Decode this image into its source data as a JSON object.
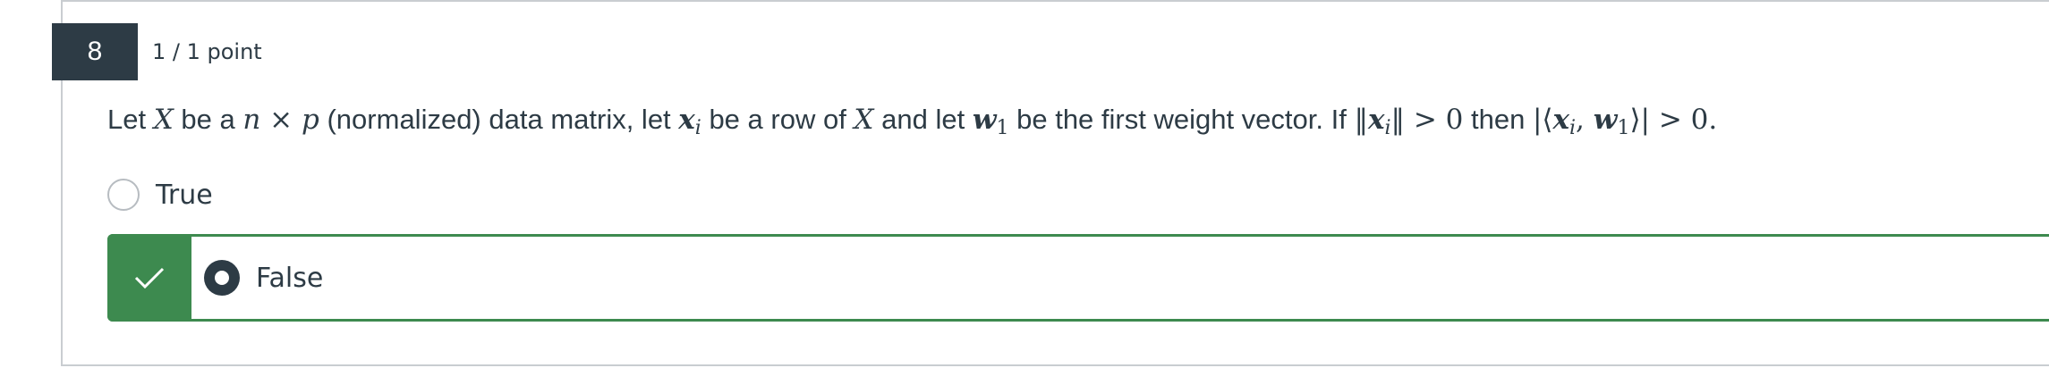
{
  "question": {
    "number": "8",
    "points": "1 / 1 point",
    "prompt": {
      "t1": "Let ",
      "X1": "X",
      "t2": " be a ",
      "n": "n",
      "times": " × ",
      "p": "p",
      "t3": " (normalized) data matrix, let ",
      "xi_x": "x",
      "xi_i": "i",
      "t4": " be a row of ",
      "X2": "X",
      "t5": " and let ",
      "w1_w": "w",
      "w1_1": "1",
      "t6": " be the first weight vector. If ",
      "norm_open": "‖",
      "norm_x": "x",
      "norm_i": "i",
      "norm_close": "‖",
      "gt1": " > 0",
      "t7": " then ",
      "abs_open": "|⟨",
      "ip_x": "x",
      "ip_i": "i",
      "comma": ", ",
      "ip_w": "w",
      "ip_1": "1",
      "abs_close": "⟩|",
      "gt2": " > 0."
    },
    "answers": [
      {
        "label": "True",
        "selected": false,
        "correct": false
      },
      {
        "label": "False",
        "selected": true,
        "correct": true
      }
    ]
  },
  "icons": {
    "check": "checkmark-icon",
    "radio_empty": "radio-unselected-icon",
    "radio_selected": "radio-selected-icon"
  },
  "colors": {
    "header_bg": "#2d3b45",
    "correct_green": "#3d8a4f",
    "border_gray": "#c9cdd1"
  }
}
